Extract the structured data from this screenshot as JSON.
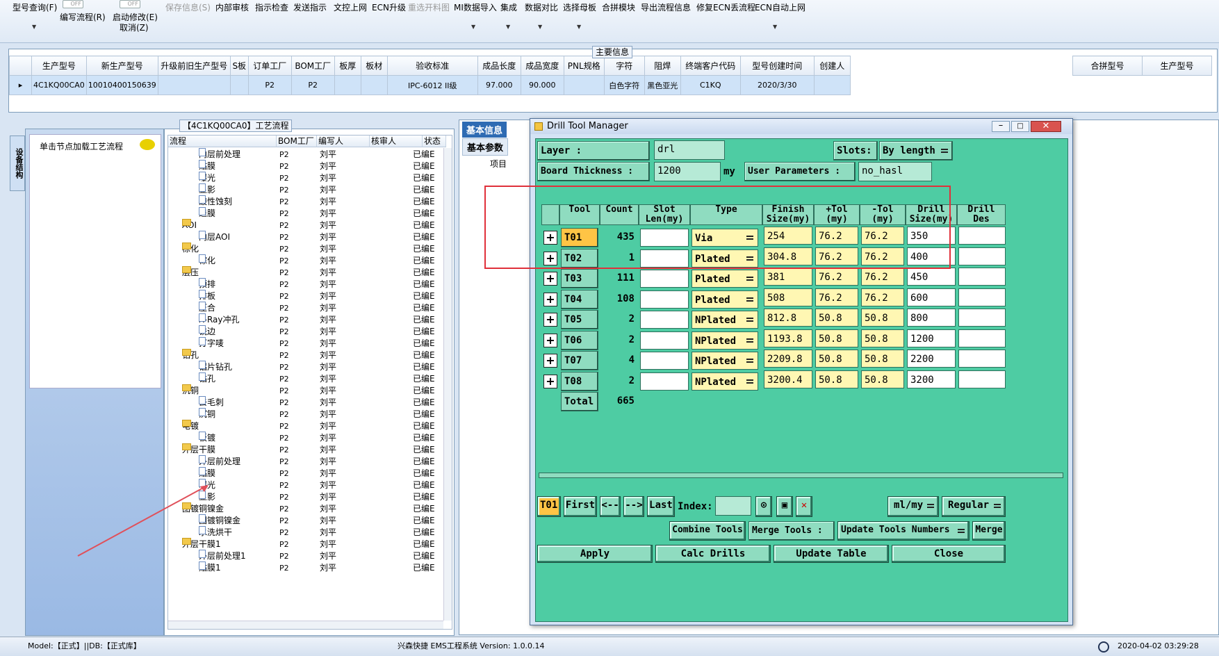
{
  "toolbar": {
    "items": [
      "型号查询(F)",
      "编写流程(R)",
      "启动修改(E)",
      "取消(Z)",
      "保存信息(S)",
      "内部审核",
      "指示检查",
      "发送指示",
      "文控上网",
      "ECN升级",
      "重选开料图",
      "MI数据导入",
      "集成",
      "数据对比",
      "选择母板",
      "合拼模块",
      "导出流程信息",
      "修复ECN丢流程",
      "ECN自动上网"
    ],
    "toggle_label": "OFF"
  },
  "main_info": {
    "section_title": "主要信息",
    "columns": [
      "生产型号",
      "新生产型号",
      "升级前旧生产型号",
      "S板",
      "订单工厂",
      "BOM工厂",
      "板厚",
      "板材",
      "验收标准",
      "成品长度",
      "成品宽度",
      "PNL规格",
      "字符",
      "阻焊",
      "终端客户代码",
      "型号创建时间",
      "创建人"
    ],
    "row": [
      "4C1KQ00CA0",
      "10010400150639",
      "",
      "",
      "P2",
      "P2",
      "",
      "",
      "IPC-6012 II级",
      "97.000",
      "90.000",
      "",
      "白色字符",
      "黑色亚光",
      "C1KQ",
      "2020/3/30",
      ""
    ],
    "right_columns": [
      "合拼型号",
      "生产型号"
    ]
  },
  "left": {
    "vtab_label": "设备结构",
    "hint": "单击节点加载工艺流程"
  },
  "process": {
    "title": "【4C1KQ00CA0】工艺流程",
    "headers": [
      "流程",
      "BOM工厂",
      "编写人",
      "核审人",
      "状态"
    ],
    "rows": [
      {
        "name": "内层前处理",
        "level": 2,
        "bom": "P2",
        "author": "刘平",
        "status": "已编E"
      },
      {
        "name": "贴膜",
        "level": 2,
        "bom": "P2",
        "author": "刘平",
        "status": "已编E"
      },
      {
        "name": "曝光",
        "level": 2,
        "bom": "P2",
        "author": "刘平",
        "status": "已编E"
      },
      {
        "name": "显影",
        "level": 2,
        "bom": "P2",
        "author": "刘平",
        "status": "已编E"
      },
      {
        "name": "酸性蚀刻",
        "level": 2,
        "bom": "P2",
        "author": "刘平",
        "status": "已编E"
      },
      {
        "name": "退膜",
        "level": 2,
        "bom": "P2",
        "author": "刘平",
        "status": "已编E"
      },
      {
        "name": "AOI",
        "level": 1,
        "bom": "P2",
        "author": "刘平",
        "status": "已编E"
      },
      {
        "name": "内层AOI",
        "level": 2,
        "bom": "P2",
        "author": "刘平",
        "status": "已编E"
      },
      {
        "name": "棕化",
        "level": 1,
        "bom": "P2",
        "author": "刘平",
        "status": "已编E"
      },
      {
        "name": "棕化",
        "level": 2,
        "bom": "P2",
        "author": "刘平",
        "status": "已编E"
      },
      {
        "name": "层压",
        "level": 1,
        "bom": "P2",
        "author": "刘平",
        "status": "已编E"
      },
      {
        "name": "预排",
        "level": 2,
        "bom": "P2",
        "author": "刘平",
        "status": "已编E"
      },
      {
        "name": "排板",
        "level": 2,
        "bom": "P2",
        "author": "刘平",
        "status": "已编E"
      },
      {
        "name": "压合",
        "level": 2,
        "bom": "P2",
        "author": "刘平",
        "status": "已编E"
      },
      {
        "name": "X-Ray冲孔",
        "level": 2,
        "bom": "P2",
        "author": "刘平",
        "status": "已编E"
      },
      {
        "name": "铣边",
        "level": 2,
        "bom": "P2",
        "author": "刘平",
        "status": "已编E"
      },
      {
        "name": "打字唛",
        "level": 2,
        "bom": "P2",
        "author": "刘平",
        "status": "已编E"
      },
      {
        "name": "钻孔",
        "level": 1,
        "bom": "P2",
        "author": "刘平",
        "status": "已编E"
      },
      {
        "name": "铝片钻孔",
        "level": 2,
        "bom": "P2",
        "author": "刘平",
        "status": "已编E"
      },
      {
        "name": "钻孔",
        "level": 2,
        "bom": "P2",
        "author": "刘平",
        "status": "已编E"
      },
      {
        "name": "沉铜",
        "level": 1,
        "bom": "P2",
        "author": "刘平",
        "status": "已编E"
      },
      {
        "name": "去毛刺",
        "level": 2,
        "bom": "P2",
        "author": "刘平",
        "status": "已编E"
      },
      {
        "name": "沉铜",
        "level": 2,
        "bom": "P2",
        "author": "刘平",
        "status": "已编E"
      },
      {
        "name": "电镀",
        "level": 1,
        "bom": "P2",
        "author": "刘平",
        "status": "已编E"
      },
      {
        "name": "板镀",
        "level": 2,
        "bom": "P2",
        "author": "刘平",
        "status": "已编E"
      },
      {
        "name": "外层干膜",
        "level": 1,
        "bom": "P2",
        "author": "刘平",
        "status": "已编E"
      },
      {
        "name": "外层前处理",
        "level": 2,
        "bom": "P2",
        "author": "刘平",
        "status": "已编E"
      },
      {
        "name": "贴膜",
        "level": 2,
        "bom": "P2",
        "author": "刘平",
        "status": "已编E"
      },
      {
        "name": "曝光",
        "level": 2,
        "bom": "P2",
        "author": "刘平",
        "status": "已编E"
      },
      {
        "name": "显影",
        "level": 2,
        "bom": "P2",
        "author": "刘平",
        "status": "已编E"
      },
      {
        "name": "图镀铜镍金",
        "level": 1,
        "bom": "P2",
        "author": "刘平",
        "status": "已编E"
      },
      {
        "name": "图镀铜镍金",
        "level": 2,
        "bom": "P2",
        "author": "刘平",
        "status": "已编E"
      },
      {
        "name": "水洗烘干",
        "level": 2,
        "bom": "P2",
        "author": "刘平",
        "status": "已编E"
      },
      {
        "name": "外层干膜1",
        "level": 1,
        "bom": "P2",
        "author": "刘平",
        "status": "已编E"
      },
      {
        "name": "外层前处理1",
        "level": 2,
        "bom": "P2",
        "author": "刘平",
        "status": "已编E"
      },
      {
        "name": "贴膜1",
        "level": 2,
        "bom": "P2",
        "author": "刘平",
        "status": "已编E"
      }
    ]
  },
  "right_tabs": {
    "basic_info": "基本信息",
    "basic_params": "基本参数",
    "item_col": "项目"
  },
  "dialog": {
    "title": "Drill Tool Manager",
    "layer_label": "Layer         :",
    "layer_value": "drl",
    "slots_label": "Slots:",
    "slots_value": "By length",
    "thickness_label": "Board Thickness :",
    "thickness_value": "1200",
    "thickness_unit": "my",
    "user_params_label": "User Parameters :",
    "user_params_value": "no_hasl",
    "columns": [
      {
        "l1": "Tool",
        "l2": ""
      },
      {
        "l1": "Count",
        "l2": ""
      },
      {
        "l1": "Slot",
        "l2": "Len(my)"
      },
      {
        "l1": "Type",
        "l2": ""
      },
      {
        "l1": "Finish",
        "l2": "Size(my)"
      },
      {
        "l1": "+Tol",
        "l2": "(my)"
      },
      {
        "l1": "-Tol",
        "l2": "(my)"
      },
      {
        "l1": "Drill",
        "l2": "Size(my)"
      },
      {
        "l1": "Drill",
        "l2": "Des"
      }
    ],
    "rows": [
      {
        "tool": "T01",
        "count": "435",
        "type": "Via",
        "finish": "254",
        "ptol": "76.2",
        "ntol": "76.2",
        "drill": "350"
      },
      {
        "tool": "T02",
        "count": "1",
        "type": "Plated",
        "finish": "304.8",
        "ptol": "76.2",
        "ntol": "76.2",
        "drill": "400"
      },
      {
        "tool": "T03",
        "count": "111",
        "type": "Plated",
        "finish": "381",
        "ptol": "76.2",
        "ntol": "76.2",
        "drill": "450"
      },
      {
        "tool": "T04",
        "count": "108",
        "type": "Plated",
        "finish": "508",
        "ptol": "76.2",
        "ntol": "76.2",
        "drill": "600"
      },
      {
        "tool": "T05",
        "count": "2",
        "type": "NPlated",
        "finish": "812.8",
        "ptol": "50.8",
        "ntol": "50.8",
        "drill": "800"
      },
      {
        "tool": "T06",
        "count": "2",
        "type": "NPlated",
        "finish": "1193.8",
        "ptol": "50.8",
        "ntol": "50.8",
        "drill": "1200"
      },
      {
        "tool": "T07",
        "count": "4",
        "type": "NPlated",
        "finish": "2209.8",
        "ptol": "50.8",
        "ntol": "50.8",
        "drill": "2200"
      },
      {
        "tool": "T08",
        "count": "2",
        "type": "NPlated",
        "finish": "3200.4",
        "ptol": "50.8",
        "ntol": "50.8",
        "drill": "3200"
      }
    ],
    "total_label": "Total",
    "total_value": "665",
    "nav": {
      "current": "T01",
      "first": "First",
      "prev": "<--",
      "next": "-->",
      "last": "Last",
      "index_label": "Index:",
      "units": "ml/my",
      "mode": "Regular"
    },
    "buttons": {
      "combine": "Combine Tools",
      "merge_label": "Merge Tools :",
      "update_numbers": "Update Tools Numbers",
      "merge": "Merge",
      "apply": "Apply",
      "calc": "Calc Drills",
      "update_table": "Update Table",
      "close": "Close"
    }
  },
  "status": {
    "model": "Model:【正式】||DB:【正式库】",
    "app": "兴森快捷 EMS工程系统  Version: 1.0.0.14",
    "datetime": "2020-04-02 03:29:28"
  },
  "colors": {
    "dialog_bg": "#4ecca3",
    "highlight_box": "#e0303a",
    "selected_tool": "#ffc445"
  }
}
